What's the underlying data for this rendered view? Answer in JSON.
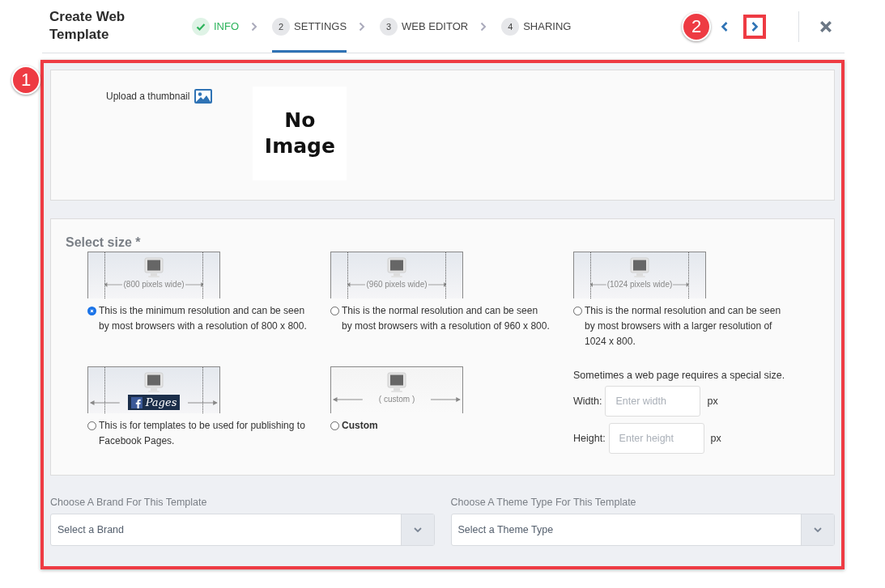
{
  "header": {
    "title": "Create Web Template",
    "steps": [
      {
        "label": "INFO",
        "completed": true,
        "selected": false
      },
      {
        "number": "2",
        "label": "SETTINGS",
        "completed": false,
        "selected": true
      },
      {
        "number": "3",
        "label": "WEB EDITOR",
        "completed": false,
        "selected": false
      },
      {
        "number": "4",
        "label": "SHARING",
        "completed": false,
        "selected": false
      }
    ]
  },
  "callouts": [
    {
      "number": "1"
    },
    {
      "number": "2"
    }
  ],
  "thumbnail": {
    "label": "Upload a thumbnail",
    "preview": "No Image"
  },
  "size": {
    "title": "Select size *",
    "options": [
      {
        "kind": "preset",
        "preview_label": "(800 pixels wide)",
        "description": "This is the minimum resolution and can be seen by most browsers with a resolution of 800 x 800.",
        "selected": true
      },
      {
        "kind": "preset",
        "preview_label": "(960 pixels wide)",
        "description": "This is the normal resolution and can be seen by most browsers with a resolution of 960 x 800.",
        "selected": false
      },
      {
        "kind": "preset",
        "preview_label": "(1024 pixels wide)",
        "description": "This is the normal resolution and can be seen by most browsers with a larger resolution of 1024 x 800.",
        "selected": false
      },
      {
        "kind": "facebook",
        "preview_label": "Pages",
        "description": "This is for templates to be used for publishing to Facebook Pages.",
        "selected": false
      },
      {
        "kind": "custom",
        "preview_label": "( custom )",
        "description": "Custom",
        "selected": false
      }
    ],
    "custom": {
      "note": "Sometimes a web page requires a special size.",
      "fields": [
        {
          "label": "Width:",
          "placeholder": "Enter width",
          "unit": "px"
        },
        {
          "label": "Height:",
          "placeholder": "Enter height",
          "unit": "px"
        }
      ]
    }
  },
  "selects": [
    {
      "label": "Choose A Brand For This Template",
      "placeholder": "Select a Brand"
    },
    {
      "label": "Choose A Theme Type For This Template",
      "placeholder": "Select a Theme Type"
    }
  ]
}
